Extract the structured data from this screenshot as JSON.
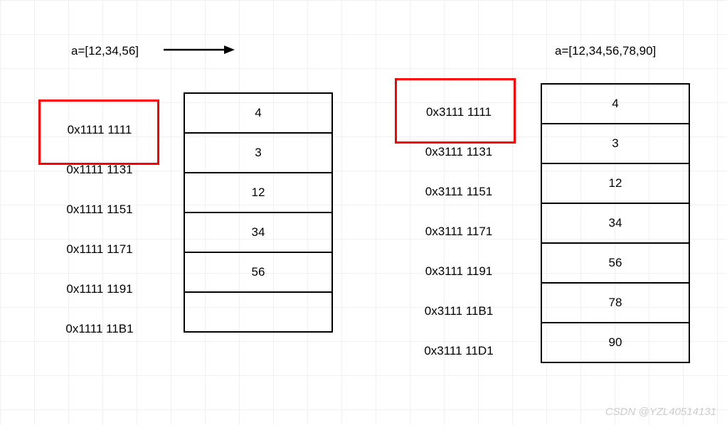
{
  "left": {
    "title": "a=[12,34,56]",
    "addresses": [
      "0x1111 1111",
      "0x1111 1131",
      "0x1111 1151",
      "0x1111 1171",
      "0x1111 1191",
      "0x1111 11B1"
    ],
    "cells": [
      "4",
      "3",
      "12",
      "34",
      "56",
      ""
    ]
  },
  "right": {
    "title": "a=[12,34,56,78,90]",
    "addresses": [
      "0x3111 1111",
      "0x3111 1131",
      "0x3111 1151",
      "0x3111 1171",
      "0x3111 1191",
      "0x3111 11B1",
      "0x3111 11D1"
    ],
    "cells": [
      "4",
      "3",
      "12",
      "34",
      "56",
      "78",
      "90"
    ]
  },
  "watermark": "CSDN @YZL40514131"
}
